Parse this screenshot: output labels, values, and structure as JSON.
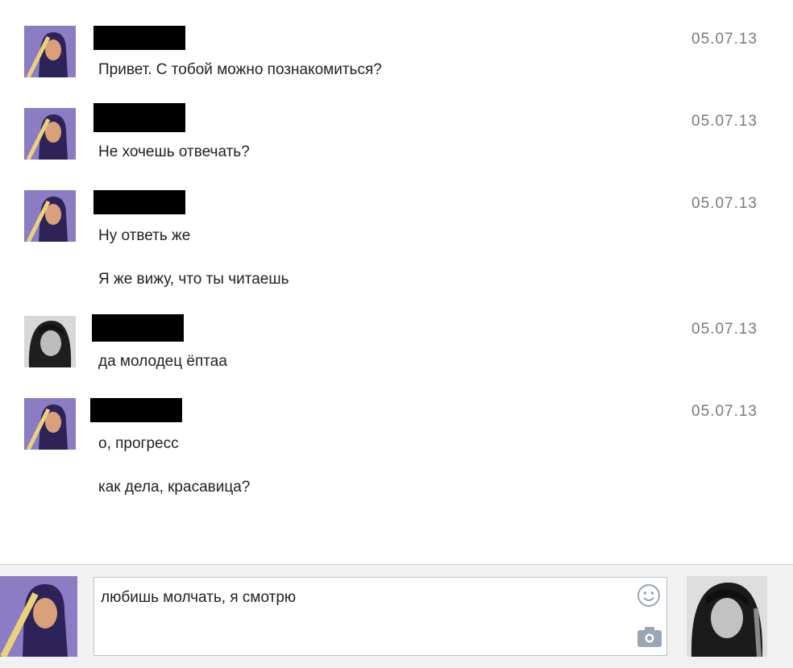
{
  "messages": [
    {
      "sender": "friend",
      "date": "05.07.13",
      "lines": [
        "Привет. С тобой можно познакомиться?"
      ]
    },
    {
      "sender": "friend",
      "date": "05.07.13",
      "lines": [
        "Не хочешь отвечать?"
      ]
    },
    {
      "sender": "friend",
      "date": "05.07.13",
      "lines": [
        "Ну ответь же",
        "Я же вижу, что ты читаешь"
      ]
    },
    {
      "sender": "me",
      "date": "05.07.13",
      "lines": [
        "да молодец ёптаа"
      ]
    },
    {
      "sender": "friend",
      "date": "05.07.13",
      "lines": [
        "о, прогресс",
        "как дела, красавица?"
      ]
    }
  ],
  "composer": {
    "draft_text": "любишь молчать, я смотрю",
    "icons": [
      "smile-icon",
      "camera-icon"
    ]
  },
  "colors": {
    "name_redaction": "#000000",
    "date_text": "#7a7a7a",
    "avatar_accent": "#7d6fb8",
    "icon_gray": "#9aa6b3"
  }
}
